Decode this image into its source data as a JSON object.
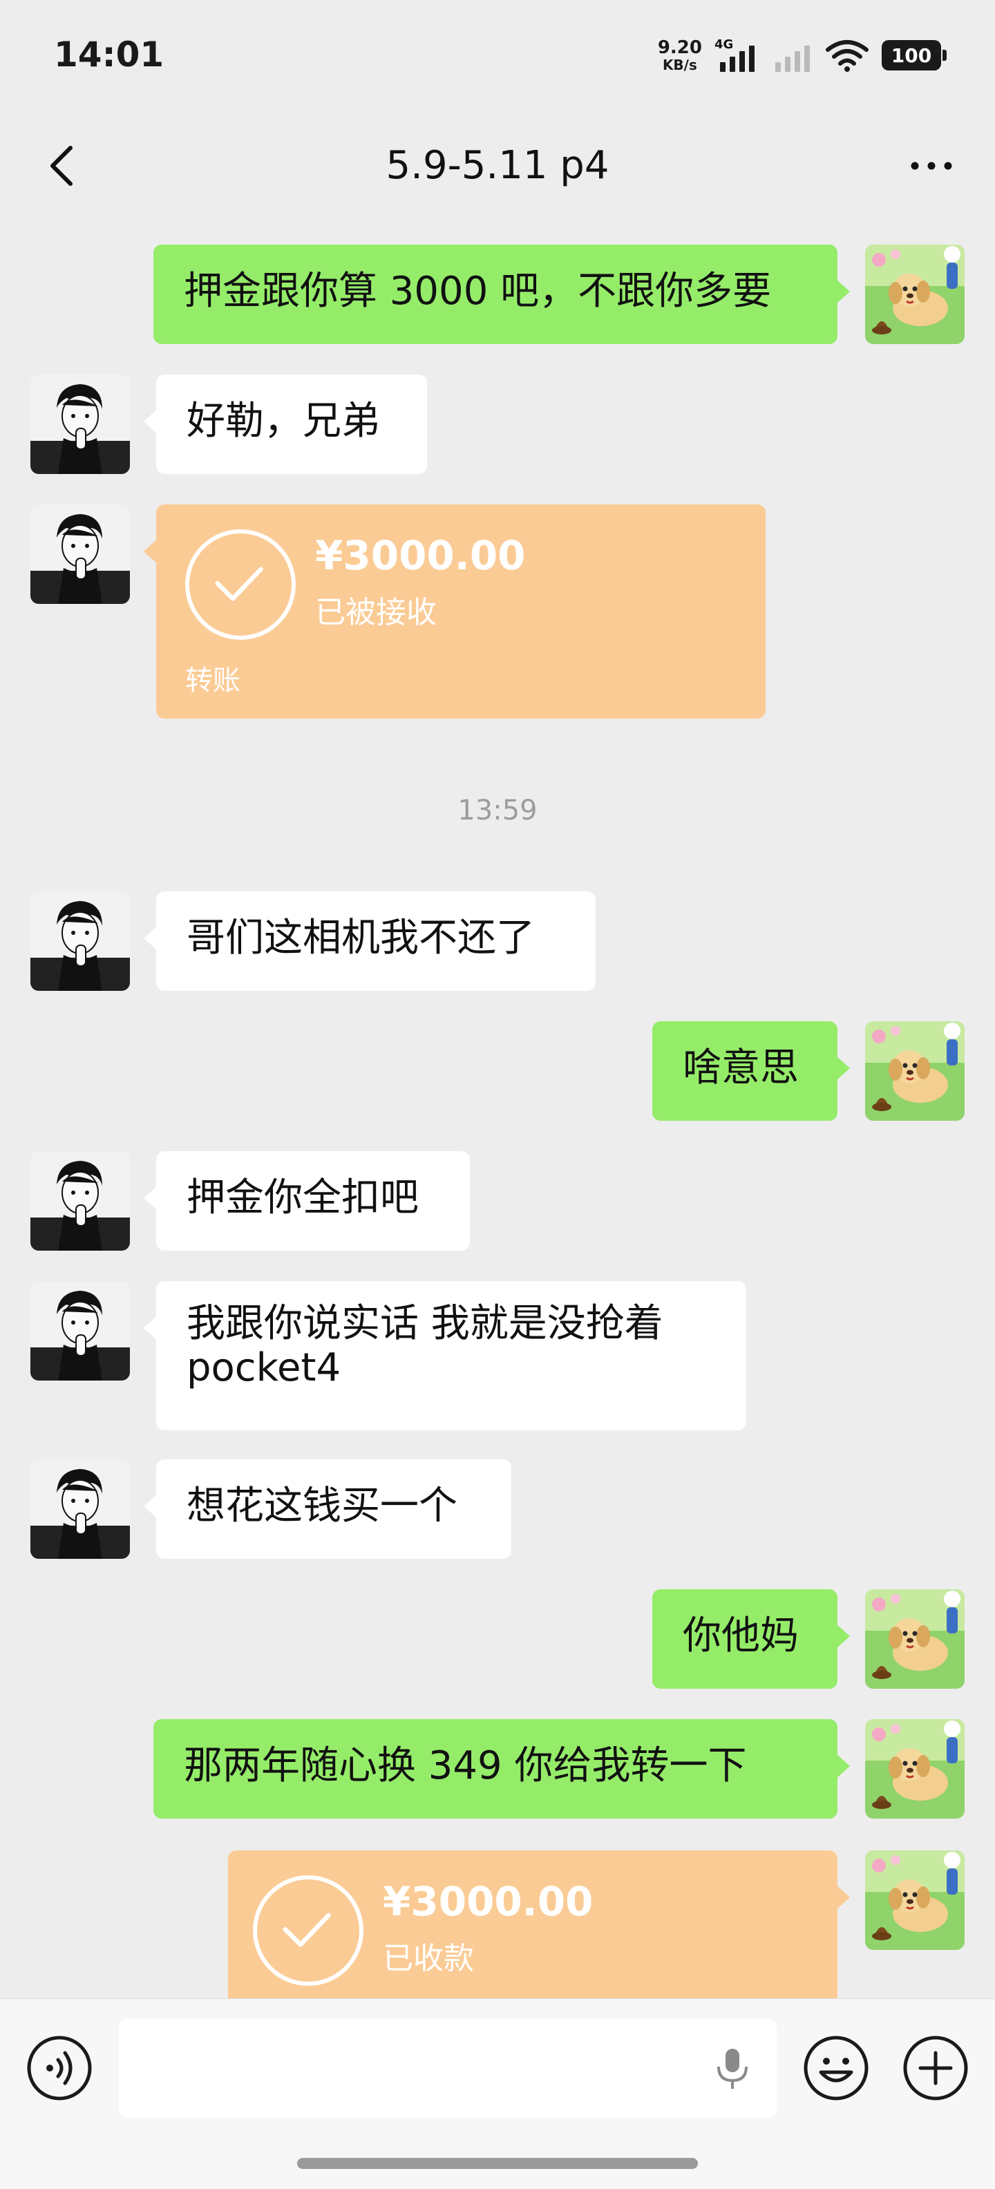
{
  "status_bar": {
    "time": "14:01",
    "net_speed_value": "9.20",
    "net_speed_unit": "KB/s",
    "network_type": "4G",
    "battery": "100"
  },
  "header": {
    "title": "5.9-5.11 p4",
    "back_icon": "chevron-left-icon",
    "more_icon": "more-dots-icon"
  },
  "messages": [
    {
      "side": "right",
      "type": "text",
      "text": "押金跟你算 3000 吧，不跟你多要"
    },
    {
      "side": "left",
      "type": "text",
      "text": "好勒，兄弟"
    },
    {
      "side": "left",
      "type": "transfer",
      "amount": "¥3000.00",
      "status": "已被接收",
      "footer": "转账"
    },
    {
      "type": "time",
      "text": "13:59"
    },
    {
      "side": "left",
      "type": "text",
      "text": "哥们这相机我不还了"
    },
    {
      "side": "right",
      "type": "text",
      "text": "啥意思"
    },
    {
      "side": "left",
      "type": "text",
      "text": "押金你全扣吧"
    },
    {
      "side": "left",
      "type": "text",
      "text": "我跟你说实话 我就是没抢着 pocket4"
    },
    {
      "side": "left",
      "type": "text",
      "text": "想花这钱买一个"
    },
    {
      "side": "right",
      "type": "text",
      "text": "你他妈"
    },
    {
      "side": "right",
      "type": "text",
      "text": "那两年随心换 349 你给我转一下"
    },
    {
      "side": "right",
      "type": "transfer",
      "amount": "¥3000.00",
      "status": "已收款"
    }
  ],
  "input_bar": {
    "placeholder": "",
    "voice_icon": "voice-icon",
    "mic_icon": "microphone-icon",
    "emoji_icon": "emoji-icon",
    "plus_icon": "plus-icon"
  },
  "colors": {
    "background": "#ededed",
    "sent_bubble": "#95ec69",
    "received_bubble": "#ffffff",
    "transfer_card": "#fbcb95",
    "timestamp": "#9c9c9c"
  }
}
